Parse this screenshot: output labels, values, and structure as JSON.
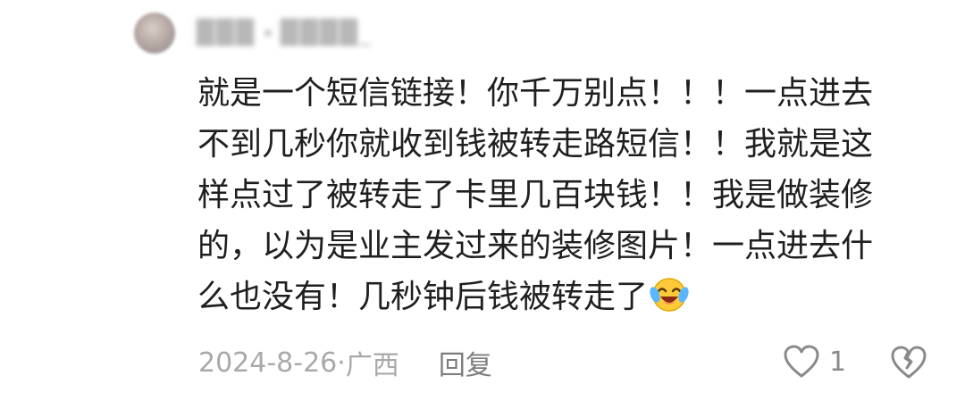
{
  "comment": {
    "author": {
      "name": "███",
      "tag": "████_"
    },
    "text_lines": [
      "就是一个短信链接！你千万别点！！！一点进去",
      "不到几秒你就收到钱被转走路短信！！我就是这",
      "样点过了被转走了卡里几百块钱！！我是做装修",
      "的，以为是业主发过来的装修图片！一点进去什",
      "么也没有！几秒钟后钱被转走了"
    ],
    "emoji": "laughing-crying-face-icon",
    "date": "2024-8-26",
    "separator": "·",
    "location": "广西",
    "reply_label": "回复",
    "like_count": "1",
    "colors": {
      "text": "#1f1f1f",
      "meta": "#a9a9a9",
      "icon": "#8a8a8a"
    }
  }
}
